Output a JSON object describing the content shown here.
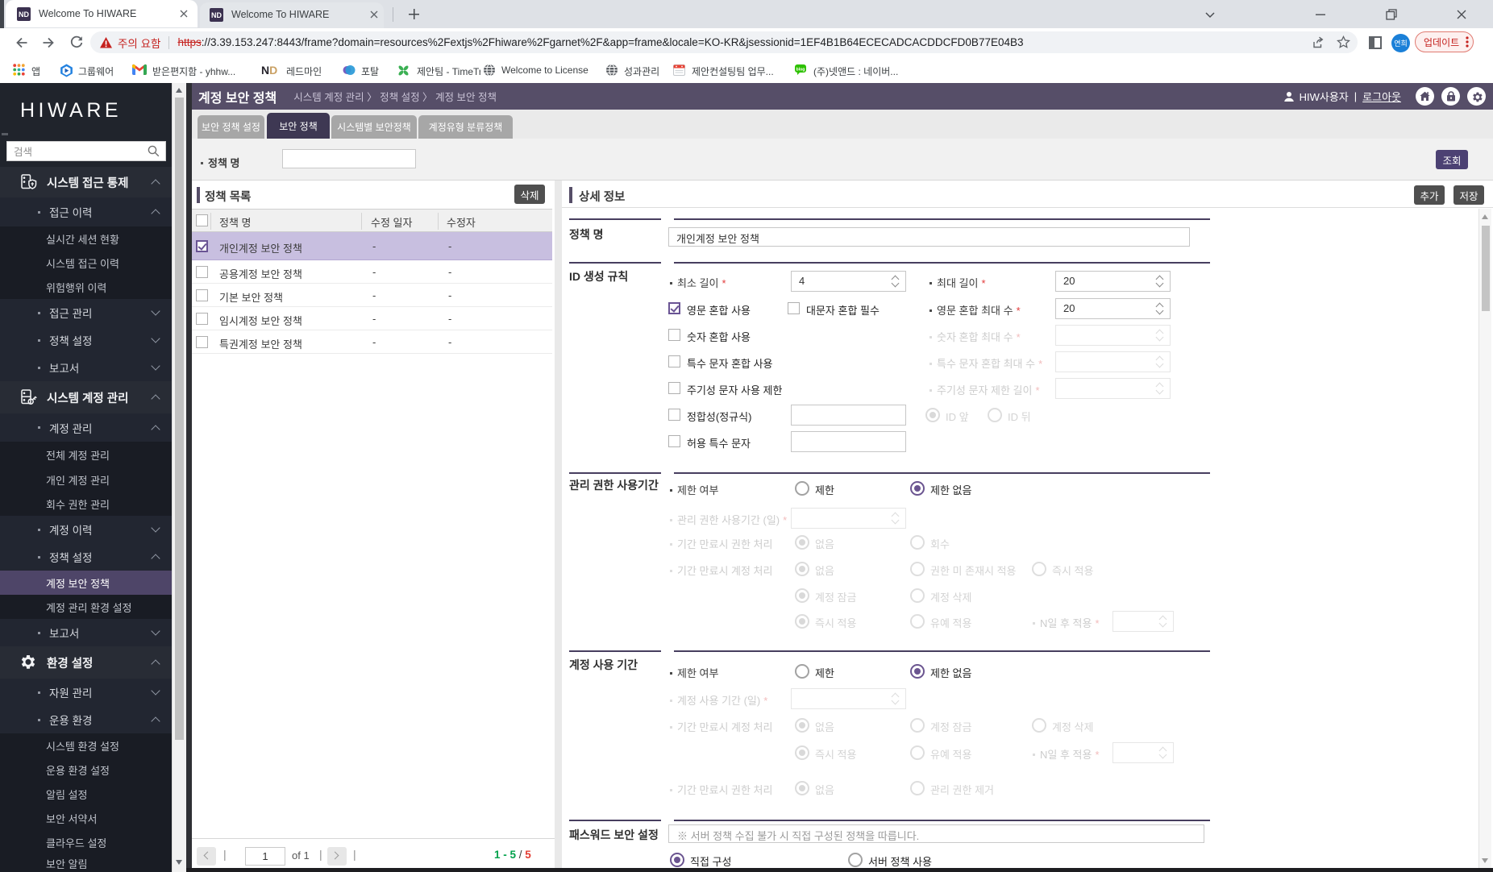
{
  "browser": {
    "tab1_title": "Welcome To HIWARE",
    "tab2_title": "Welcome To HIWARE",
    "favicon_text": "ND",
    "warning_text": "주의 요함",
    "url_scheme": "https",
    "url_rest": "://3.39.153.247:8443/frame?domain=resources%2Fextjs%2Fhiware%2Fgarnet%2F&app=frame&locale=KO-KR&jsessionid=1EF4B1B64ECECADCACDDCFD0B77E04B3",
    "profile_name": "연희",
    "update_button": "업데이트",
    "bookmarks": [
      {
        "label": "앱"
      },
      {
        "label": "그룹웨어"
      },
      {
        "label": "받은편지함 - yhhw..."
      },
      {
        "label": "레드마인"
      },
      {
        "label": "포탈"
      },
      {
        "label": "제안팀 - TimeTree"
      },
      {
        "label": "Welcome to License"
      },
      {
        "label": "성과관리"
      },
      {
        "label": "제안컨설팅팀 업무..."
      },
      {
        "label": "(주)넷앤드 : 네이버..."
      }
    ]
  },
  "sidebar": {
    "logo": "HIWARE",
    "search_placeholder": "검색",
    "items": [
      {
        "label": "시스템 접근 통제"
      },
      {
        "label": "접근 이력"
      },
      {
        "label": "실시간 세션 현황"
      },
      {
        "label": "시스템 접근 이력"
      },
      {
        "label": "위험행위 이력"
      },
      {
        "label": "접근 관리"
      },
      {
        "label": "정책 설정"
      },
      {
        "label": "보고서"
      },
      {
        "label": "시스템 계정 관리"
      },
      {
        "label": "계정 관리"
      },
      {
        "label": "전체 계정 관리"
      },
      {
        "label": "개인 계정 관리"
      },
      {
        "label": "회수 권한 관리"
      },
      {
        "label": "계정 이력"
      },
      {
        "label": "정책 설정"
      },
      {
        "label": "계정 보안 정책"
      },
      {
        "label": "계정 관리 환경 설정"
      },
      {
        "label": "보고서"
      },
      {
        "label": "환경 설정"
      },
      {
        "label": "자원 관리"
      },
      {
        "label": "운용 환경"
      },
      {
        "label": "시스템 환경 설정"
      },
      {
        "label": "운용 환경 설정"
      },
      {
        "label": "알림 설정"
      },
      {
        "label": "보안 서약서"
      },
      {
        "label": "클라우드 설정"
      },
      {
        "label": "보안 알림"
      }
    ]
  },
  "header": {
    "title": "계정 보안 정책",
    "breadcrumb": "시스템 계정 관리 〉 정책 설정 〉 계정 보안 정책",
    "user": "HIW사용자",
    "divider": "|",
    "logout": "로그아웃"
  },
  "tabs": [
    {
      "label": "보안 정책 설정"
    },
    {
      "label": "보안 정책"
    },
    {
      "label": "시스템별 보안정책"
    },
    {
      "label": "계정유형 분류정책"
    }
  ],
  "filter": {
    "policy_name_label": "정책 명",
    "policy_name_value": "",
    "search_button": "조회"
  },
  "policy_list": {
    "title": "정책 목록",
    "delete_button": "삭제",
    "columns": [
      "정책 명",
      "수정 일자",
      "수정자"
    ],
    "rows": [
      {
        "name": "개인계정 보안 정책",
        "modified_date": "-",
        "modifier": "-"
      },
      {
        "name": "공용계정 보안 정책",
        "modified_date": "-",
        "modifier": "-"
      },
      {
        "name": "기본 보안 정책",
        "modified_date": "-",
        "modifier": "-"
      },
      {
        "name": "임시계정 보안 정책",
        "modified_date": "-",
        "modifier": "-"
      },
      {
        "name": "특권계정 보안 정책",
        "modified_date": "-",
        "modifier": "-"
      }
    ],
    "pager": {
      "page": "1",
      "of": "of 1",
      "range": "1 - 5",
      "sep": "/",
      "total": "5"
    }
  },
  "detail": {
    "title": "상세 정보",
    "add_button": "추가",
    "save_button": "저장",
    "policy_name": {
      "label": "정책 명",
      "value": "개인계정 보안 정책"
    },
    "id_rules": {
      "label": "ID 생성 규칙",
      "min_len": "최소 길이",
      "min_len_value": "4",
      "max_len": "최대 길이",
      "max_len_value": "20",
      "eng_mix": "영문 혼합 사용",
      "upper_req": "대문자 혼합 필수",
      "eng_max": "영문 혼합 최대 수",
      "eng_max_value": "20",
      "num_mix": "숫자 혼합 사용",
      "num_max": "숫자 혼합 최대 수",
      "sp_mix": "특수 문자 혼합 사용",
      "sp_max": "특수 문자 혼합 최대 수",
      "period_mix": "주기성 문자 사용 제한",
      "period_len": "주기성 문자 제한 길이",
      "regex": "정합성(정규식)",
      "id_front": "ID 앞",
      "id_back": "ID 뒤",
      "allow_sp": "허용 특수 문자"
    },
    "admin_period": {
      "label": "관리 권한 사용기간",
      "limit_label": "제한 여부",
      "limit": "제한",
      "no_limit": "제한 없음",
      "days": "관리 권한 사용기간 (일)",
      "perm_expire": "기간 만료시 권한 처리",
      "none": "없음",
      "retrieve": "회수",
      "acct_expire": "기간 만료시 계정 처리",
      "no_perm": "권한 미 존재시 적용",
      "now": "즉시 적용",
      "lock": "계정 잠금",
      "delete": "계정 삭제",
      "defer": "유예 적용",
      "ndays": "N일 후 적용"
    },
    "account_period": {
      "label": "계정 사용 기간",
      "limit_label": "제한 여부",
      "limit": "제한",
      "no_limit": "제한 없음",
      "days": "계정 사용 기간 (일)",
      "acct_expire": "기간 만료시 계정 처리",
      "none": "없음",
      "lock": "계정 잠금",
      "delete": "계정 삭제",
      "now": "즉시 적용",
      "defer": "유예 적용",
      "ndays": "N일 후 적용",
      "perm_expire": "기간 만료시 권한 처리",
      "perm_remove": "관리 권한 제거"
    },
    "password": {
      "label": "패스워드 보안 설정",
      "notice": "※ 서버 정책 수집 불가 시 직접 구성된 정책을 따릅니다.",
      "direct": "직접 구성",
      "server": "서버 정책 사용"
    }
  },
  "colors": {
    "accent_purple": "#564e68",
    "active_tab": "#3e3853",
    "button_purple": "#4c4173",
    "button_dark": "#4f4f4f",
    "selected_row": "#c8bfe0",
    "active_menu": "#4e4568",
    "range_green": "#00a14b",
    "total_red": "#e23c32"
  }
}
